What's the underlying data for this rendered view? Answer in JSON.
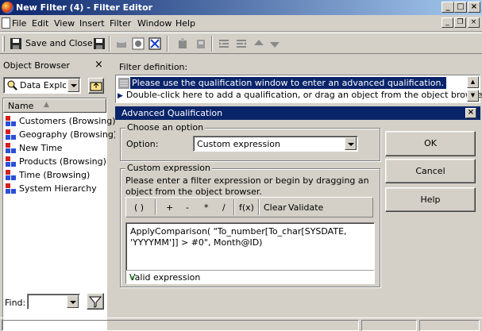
{
  "window": {
    "title": "New Filter (4) - Filter Editor"
  },
  "menu": {
    "items": [
      "File",
      "Edit",
      "View",
      "Insert",
      "Filter",
      "Window",
      "Help"
    ]
  },
  "toolbar": {
    "save_close_label": "Save and Close"
  },
  "object_browser": {
    "title": "Object Browser",
    "source": "Data Explorer",
    "column_header": "Name",
    "items": [
      "Customers (Browsing)",
      "Geography (Browsing)",
      "New Time",
      "Products (Browsing)",
      "Time (Browsing)",
      "System Hierarchy"
    ],
    "find_label": "Find:",
    "find_value": ""
  },
  "filter_definition": {
    "label": "Filter definition:",
    "rows": [
      "Please use the qualification window to enter an advanced qualification.",
      "Double-click here to add a qualification, or drag an object from the object browser."
    ]
  },
  "dialog": {
    "title": "Advanced Qualification",
    "choose_group": "Choose an option",
    "option_label": "Option:",
    "option_value": "Custom expression",
    "custom_group": "Custom expression",
    "help_text": "Please enter a filter expression or begin by dragging an object from the object browser.",
    "expr_buttons": [
      "( )",
      "+",
      "-",
      "*",
      "/",
      "f(x)",
      "Clear",
      "Validate"
    ],
    "expression": "ApplyComparison( \"To_number[To_char[SYSDATE, 'YYYYMM']] > #0\", Month@ID)",
    "status": "Valid expression",
    "ok": "OK",
    "cancel": "Cancel",
    "help": "Help"
  }
}
